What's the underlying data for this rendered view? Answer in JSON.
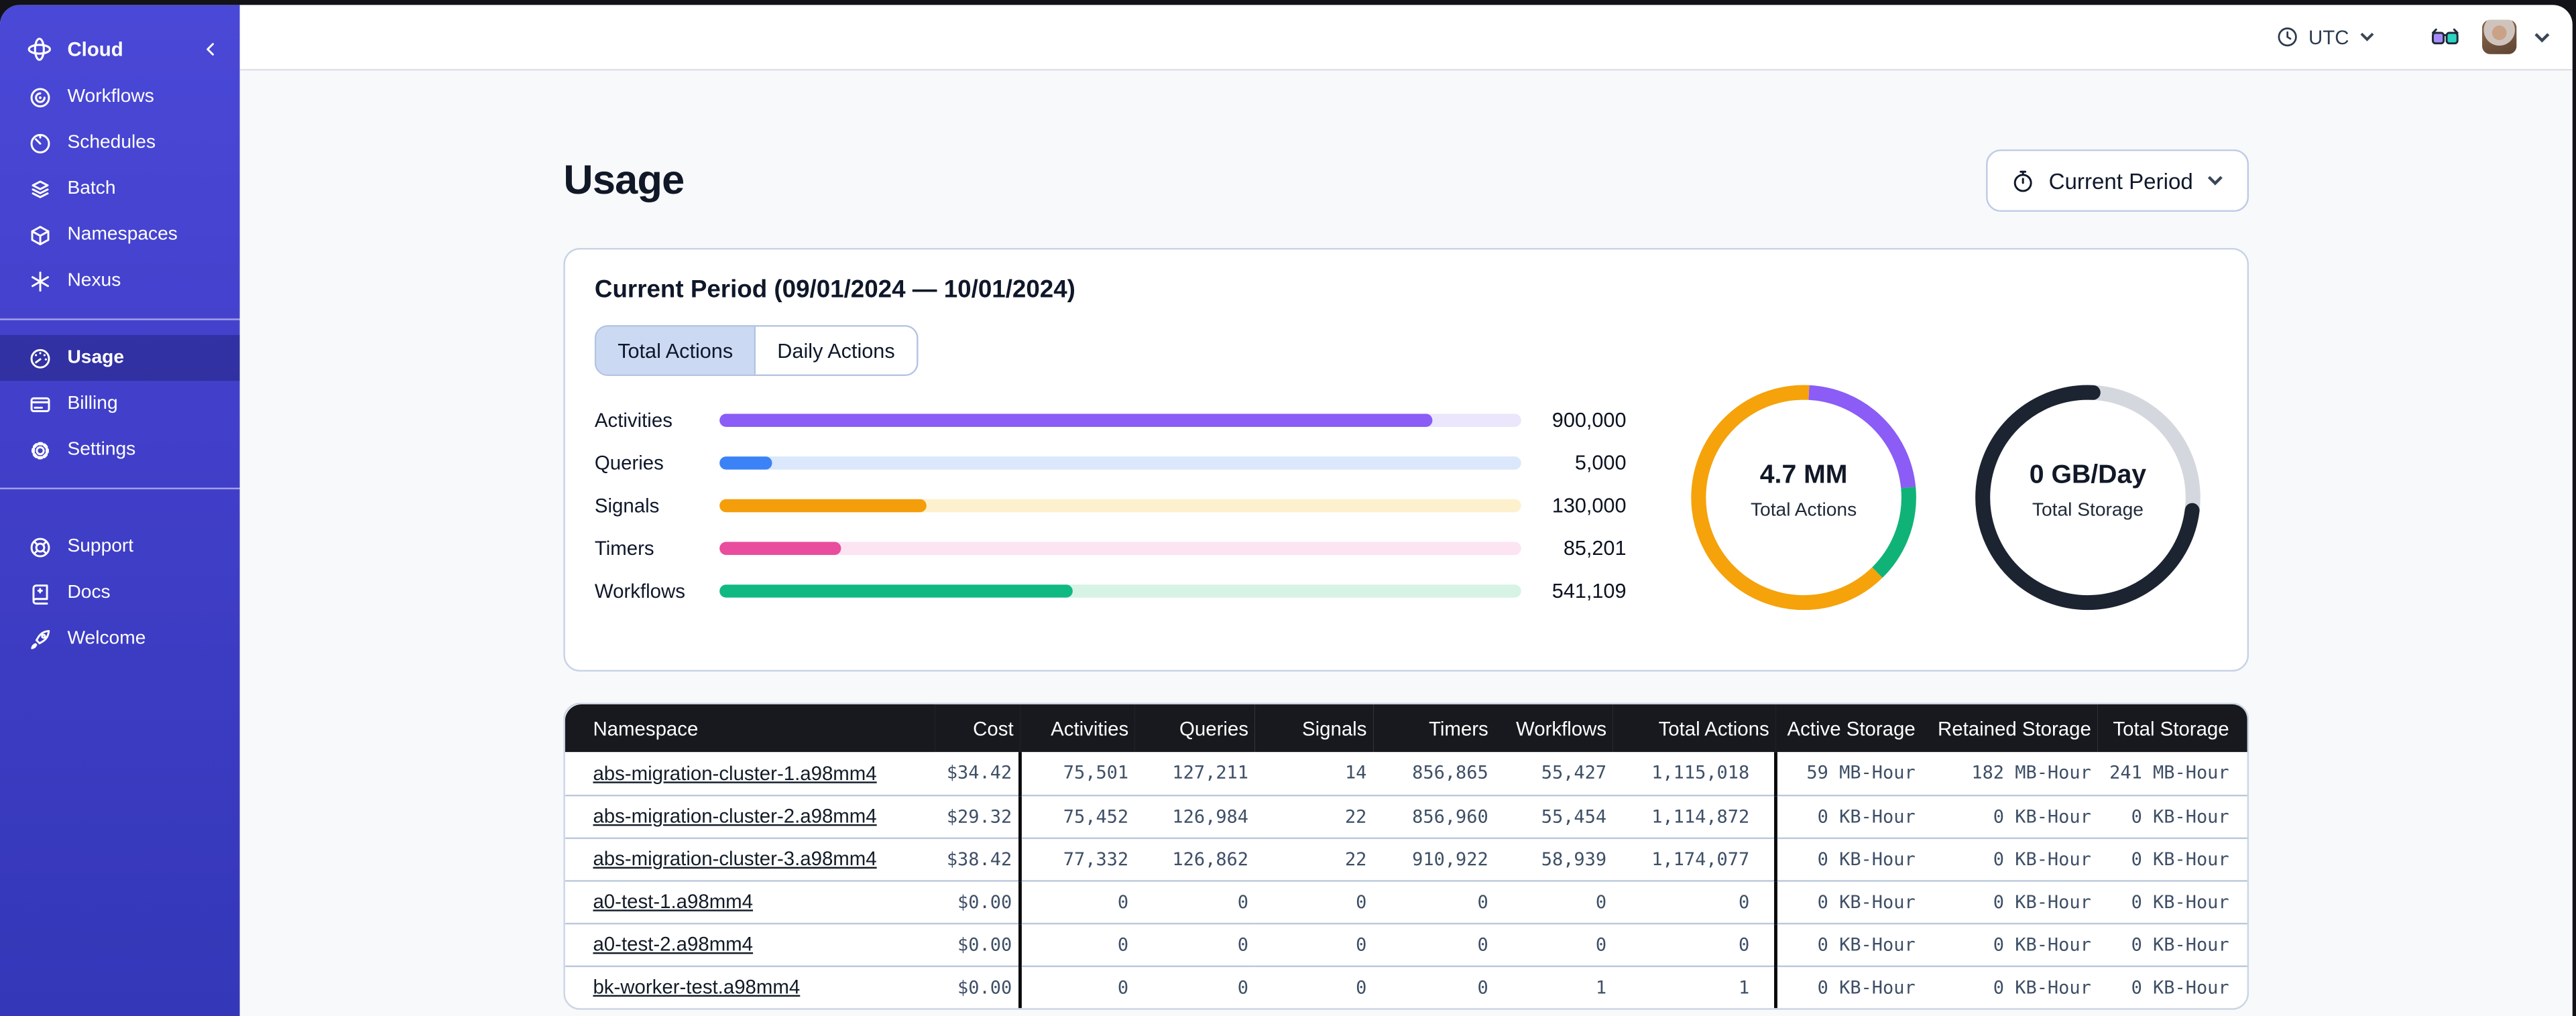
{
  "sidebar": {
    "header": {
      "label": "Cloud"
    },
    "sections": [
      {
        "items": [
          {
            "label": "Workflows"
          },
          {
            "label": "Schedules"
          },
          {
            "label": "Batch"
          },
          {
            "label": "Namespaces"
          },
          {
            "label": "Nexus"
          }
        ]
      },
      {
        "items": [
          {
            "label": "Usage",
            "selected": true
          },
          {
            "label": "Billing"
          },
          {
            "label": "Settings"
          }
        ]
      },
      {
        "items": [
          {
            "label": "Support"
          },
          {
            "label": "Docs"
          },
          {
            "label": "Welcome"
          }
        ]
      }
    ]
  },
  "topbar": {
    "timezone": "UTC"
  },
  "page": {
    "title": "Usage",
    "period_selector": "Current Period"
  },
  "usage_card": {
    "title": "Current Period (09/01/2024 — 10/01/2024)",
    "tabs": [
      {
        "label": "Total Actions",
        "selected": true
      },
      {
        "label": "Daily Actions",
        "selected": false
      }
    ]
  },
  "chart_data": [
    {
      "type": "bar",
      "title": "Total Actions by type",
      "categories": [
        "Activities",
        "Queries",
        "Signals",
        "Timers",
        "Workflows"
      ],
      "values": [
        900000,
        5000,
        130000,
        85201,
        541109
      ],
      "value_labels": [
        "900,000",
        "5,000",
        "130,000",
        "85,201",
        "541,109"
      ],
      "fill_pct": [
        89,
        6.5,
        25.8,
        15.2,
        44
      ],
      "colors": [
        "#8b5cf6",
        "#3b82f6",
        "#f59e0b",
        "#e94d9d",
        "#10b981"
      ],
      "track_colors": [
        "#ebe6fc",
        "#dbe7fb",
        "#fdf1cd",
        "#fce4f3",
        "#d7f3e6"
      ]
    },
    {
      "type": "donut",
      "label": "4.7 MM",
      "sublabel": "Total Actions",
      "segments": [
        {
          "name": "activities",
          "color": "#8b5cf6",
          "start": 0.8,
          "pct": 22.7,
          "cap": "butt"
        },
        {
          "name": "workflows",
          "color": "#10b377",
          "start": 23.5,
          "pct": 14.2,
          "cap": "butt"
        },
        {
          "name": "signals",
          "color": "#f5a20b",
          "start": 37.7,
          "pct": 63.1,
          "cap": "butt"
        }
      ]
    },
    {
      "type": "donut",
      "label": "0 GB/Day",
      "sublabel": "Total Storage",
      "segments": [
        {
          "name": "remaining",
          "color": "#d4d8de",
          "start": 0.8,
          "pct": 26.2,
          "cap": "butt"
        },
        {
          "name": "used",
          "color": "#1c2431",
          "start": 27.0,
          "pct": 73.8,
          "cap": "round"
        }
      ]
    }
  ],
  "table": {
    "columns": [
      "Namespace",
      "Cost",
      "Activities",
      "Queries",
      "Signals",
      "Timers",
      "Workflows",
      "Total Actions",
      "Active Storage",
      "Retained Storage",
      "Total Storage"
    ],
    "rows": [
      {
        "namespace": "abs-migration-cluster-1.a98mm4",
        "cost": "$34.42",
        "activities": "75,501",
        "queries": "127,211",
        "signals": "14",
        "timers": "856,865",
        "workflows": "55,427",
        "total_actions": "1,115,018",
        "active_storage": "59 MB-Hour",
        "retained_storage": "182 MB-Hour",
        "total_storage": "241 MB-Hour"
      },
      {
        "namespace": "abs-migration-cluster-2.a98mm4",
        "cost": "$29.32",
        "activities": "75,452",
        "queries": "126,984",
        "signals": "22",
        "timers": "856,960",
        "workflows": "55,454",
        "total_actions": "1,114,872",
        "active_storage": "0 KB-Hour",
        "retained_storage": "0 KB-Hour",
        "total_storage": "0 KB-Hour"
      },
      {
        "namespace": "abs-migration-cluster-3.a98mm4",
        "cost": "$38.42",
        "activities": "77,332",
        "queries": "126,862",
        "signals": "22",
        "timers": "910,922",
        "workflows": "58,939",
        "total_actions": "1,174,077",
        "active_storage": "0 KB-Hour",
        "retained_storage": "0 KB-Hour",
        "total_storage": "0 KB-Hour"
      },
      {
        "namespace": "a0-test-1.a98mm4",
        "cost": "$0.00",
        "activities": "0",
        "queries": "0",
        "signals": "0",
        "timers": "0",
        "workflows": "0",
        "total_actions": "0",
        "active_storage": "0 KB-Hour",
        "retained_storage": "0 KB-Hour",
        "total_storage": "0 KB-Hour"
      },
      {
        "namespace": "a0-test-2.a98mm4",
        "cost": "$0.00",
        "activities": "0",
        "queries": "0",
        "signals": "0",
        "timers": "0",
        "workflows": "0",
        "total_actions": "0",
        "active_storage": "0 KB-Hour",
        "retained_storage": "0 KB-Hour",
        "total_storage": "0 KB-Hour"
      },
      {
        "namespace": "bk-worker-test.a98mm4",
        "cost": "$0.00",
        "activities": "0",
        "queries": "0",
        "signals": "0",
        "timers": "0",
        "workflows": "1",
        "total_actions": "1",
        "active_storage": "0 KB-Hour",
        "retained_storage": "0 KB-Hour",
        "total_storage": "0 KB-Hour"
      }
    ]
  }
}
